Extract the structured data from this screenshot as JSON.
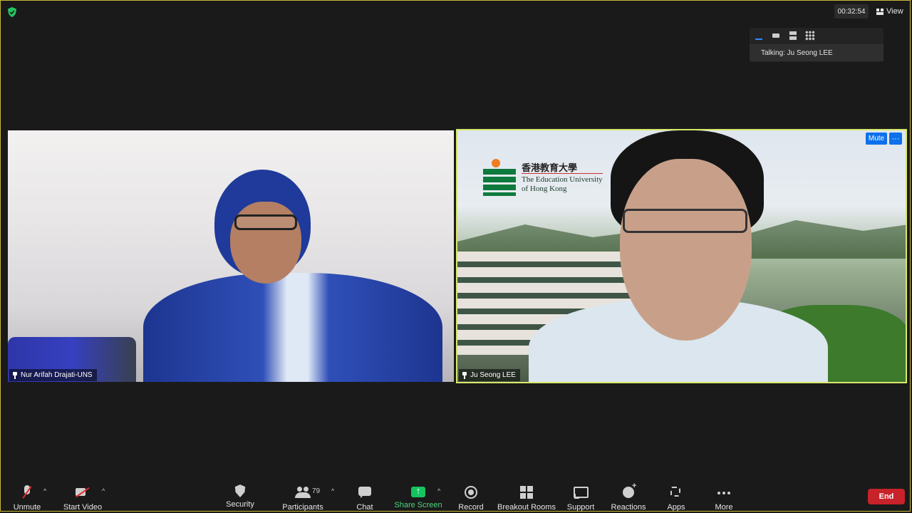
{
  "topbar": {
    "timer": "00:32:54",
    "view_label": "View"
  },
  "talking_panel": {
    "talking_text": "Talking: Ju Seong LEE"
  },
  "participants": [
    {
      "name": "Nur Arifah Drajati-UNS"
    },
    {
      "name": "Ju Seong LEE"
    }
  ],
  "video_controls": {
    "mute_label": "Mute",
    "more_label": "···"
  },
  "background": {
    "university_zh": "香港教育大學",
    "university_en_line1": "The Education University",
    "university_en_line2": "of Hong Kong"
  },
  "toolbar": {
    "unmute": "Unmute",
    "start_video": "Start Video",
    "security": "Security",
    "participants": "Participants",
    "participants_count": "79",
    "chat": "Chat",
    "share_screen": "Share Screen",
    "record": "Record",
    "breakout_rooms": "Breakout Rooms",
    "support": "Support",
    "reactions": "Reactions",
    "apps": "Apps",
    "more": "More",
    "end": "End",
    "caret": "^"
  },
  "colors": {
    "active_speaker_border": "#d8e86a",
    "window_border": "#c9b937",
    "share_green": "#13c45f",
    "end_red": "#c8222a",
    "accent_blue": "#0e71eb"
  }
}
